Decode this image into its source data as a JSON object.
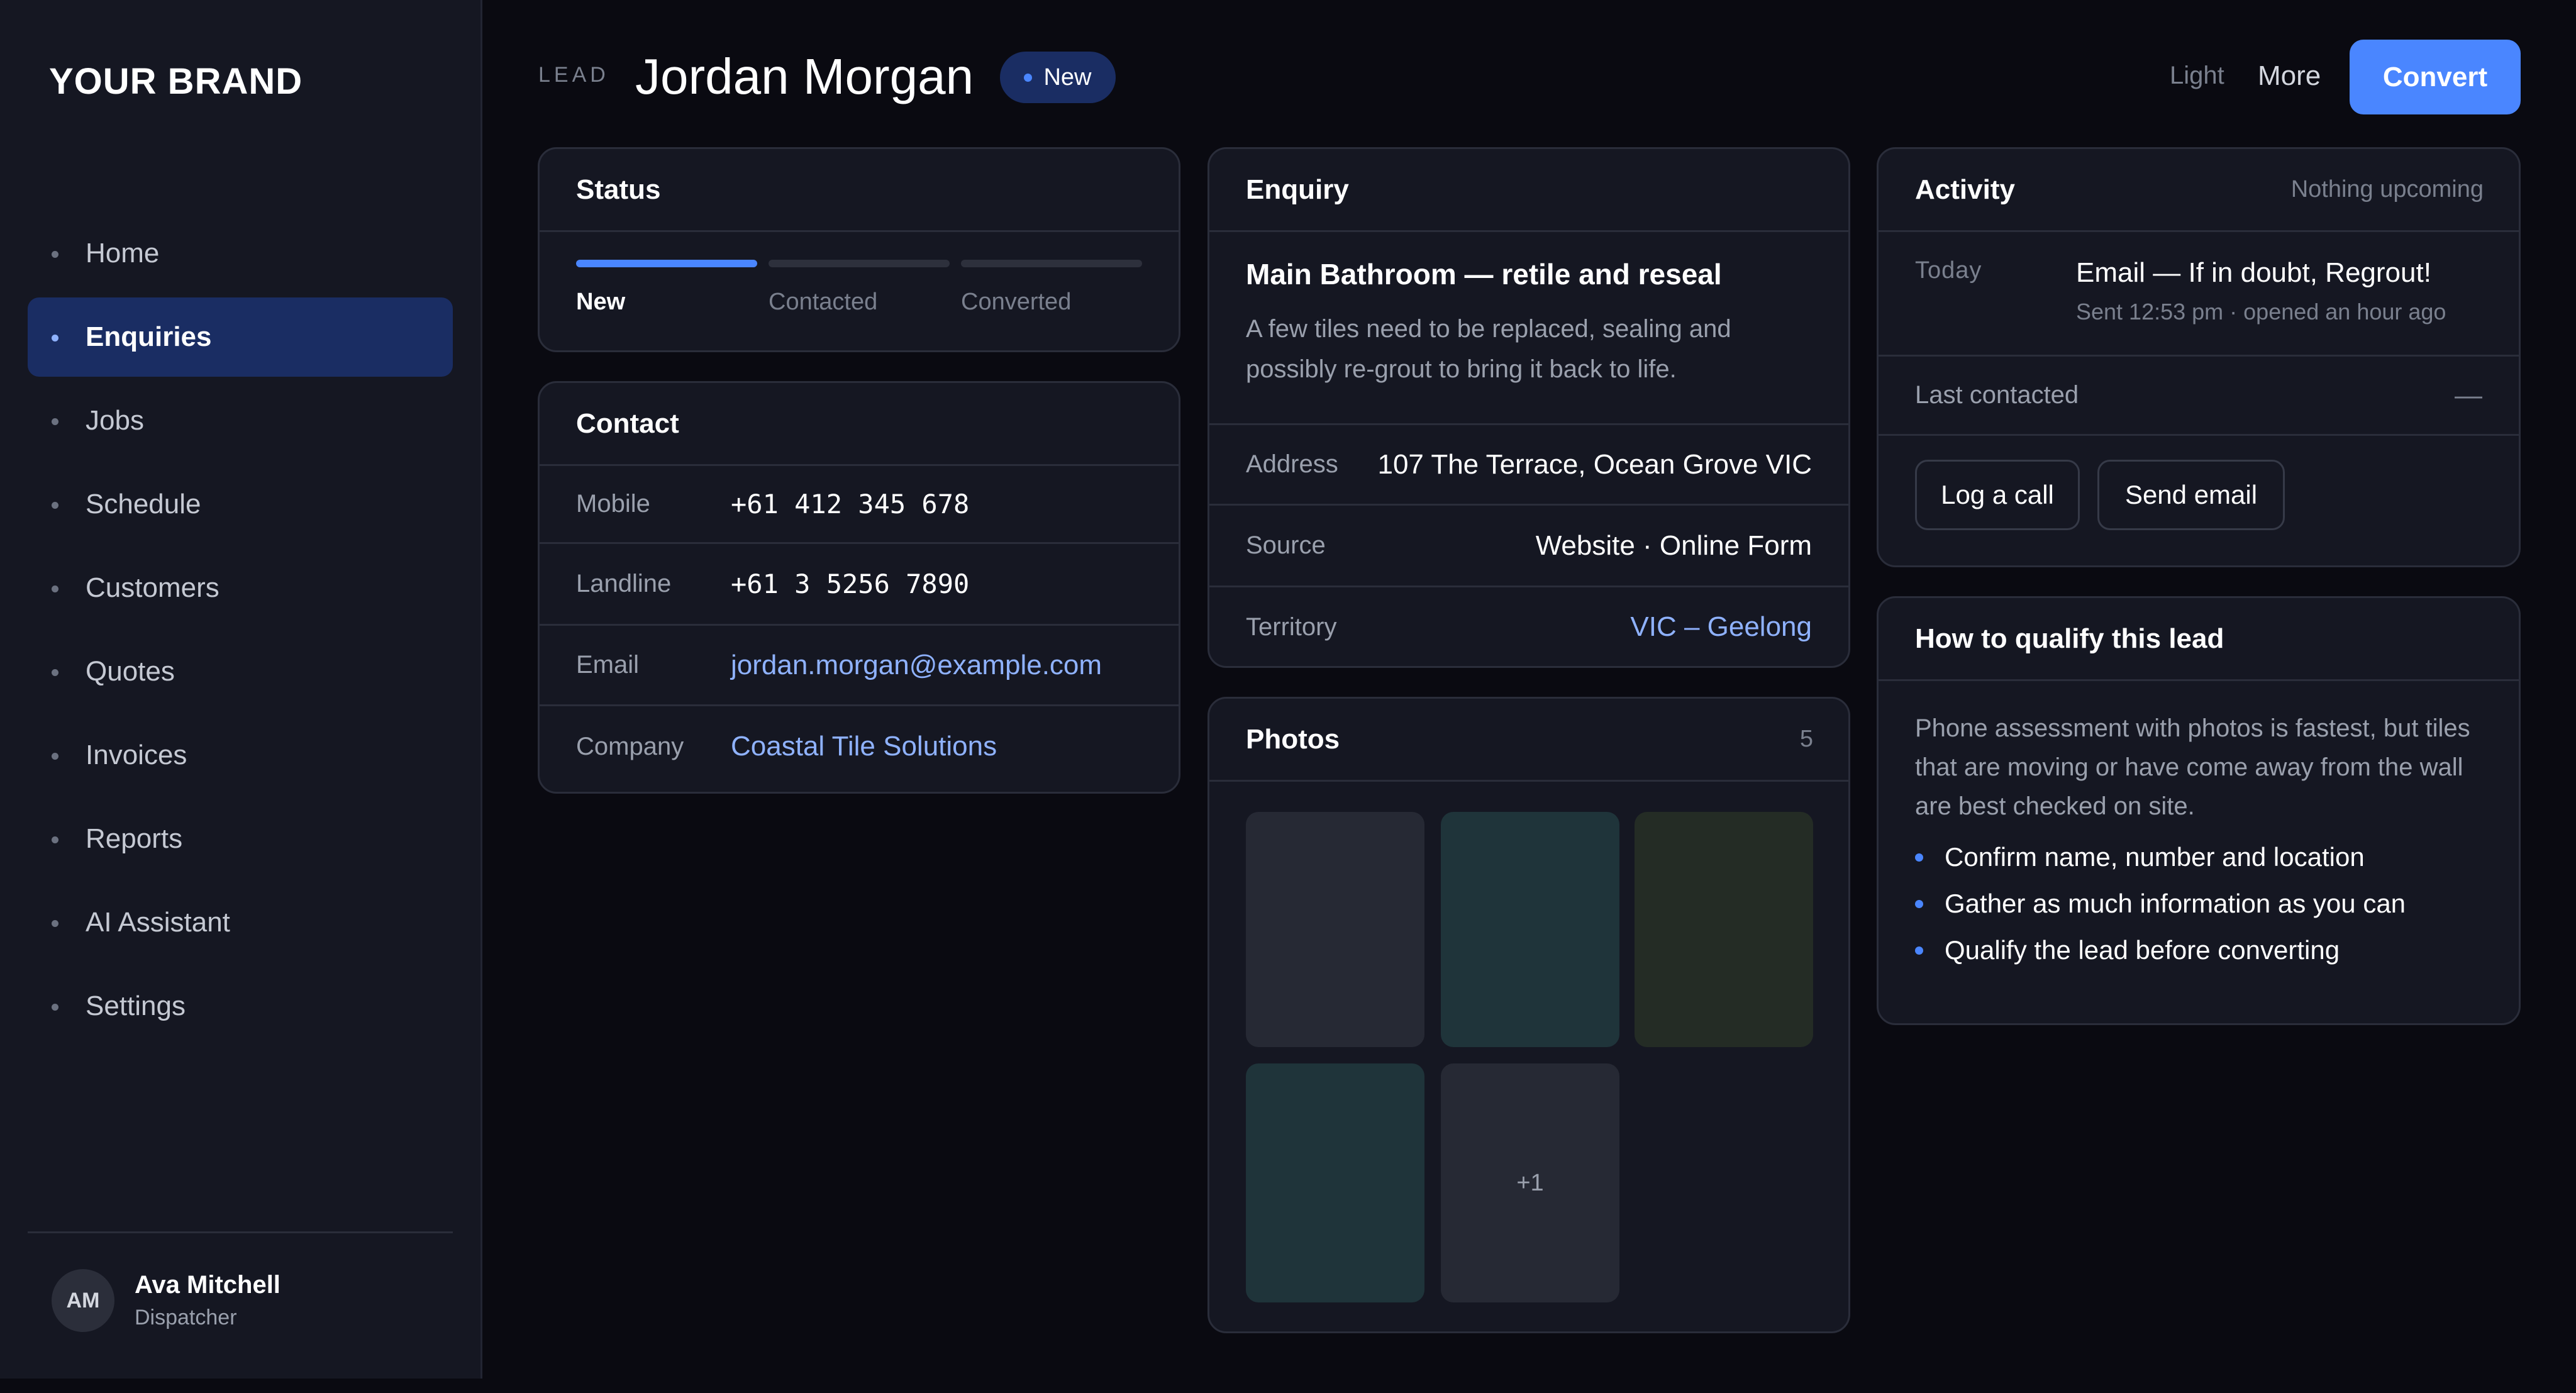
{
  "brand": "YOUR BRAND",
  "nav": {
    "items": [
      {
        "label": "Home"
      },
      {
        "label": "Enquiries",
        "active": true
      },
      {
        "label": "Jobs"
      },
      {
        "label": "Schedule"
      },
      {
        "label": "Customers"
      },
      {
        "label": "Quotes"
      },
      {
        "label": "Invoices"
      },
      {
        "label": "Reports"
      },
      {
        "label": "AI Assistant"
      },
      {
        "label": "Settings"
      }
    ]
  },
  "user": {
    "initials": "AM",
    "name": "Ava Mitchell",
    "role": "Dispatcher"
  },
  "header": {
    "lead_label": "LEAD",
    "name": "Jordan Morgan",
    "badge": "New",
    "light": "Light",
    "more": "More",
    "convert": "Convert"
  },
  "status": {
    "title": "Status",
    "steps": [
      "New",
      "Contacted",
      "Converted"
    ],
    "current_step": "New"
  },
  "contact": {
    "title": "Contact",
    "rows": [
      {
        "key": "Mobile",
        "value": "+61 412 345 678"
      },
      {
        "key": "Landline",
        "value": "+61 3 5256 7890"
      },
      {
        "key": "Email",
        "value": "jordan.morgan@example.com"
      },
      {
        "key": "Company",
        "value": "Coastal Tile Solutions"
      }
    ]
  },
  "enquiry": {
    "title": "Enquiry",
    "subject": "Main Bathroom — retile and reseal",
    "description": "A few tiles need to be replaced, sealing and possibly re-grout to bring it back to life.",
    "rows": [
      {
        "key": "Address",
        "value": "107 The Terrace, Ocean Grove VIC"
      },
      {
        "key": "Source",
        "value": "Website · Online Form"
      },
      {
        "key": "Territory",
        "value": "VIC – Geelong"
      }
    ]
  },
  "photos": {
    "title": "Photos",
    "count": "5",
    "more": "+1",
    "tile_colors": [
      "#262934",
      "#1f343a",
      "#242c25",
      "#1f343a",
      "#262934"
    ]
  },
  "activity": {
    "title": "Activity",
    "upcoming": "Nothing upcoming",
    "today_label": "Today",
    "item_title": "Email — If in doubt, Regrout!",
    "item_sub": "Sent 12:53 pm · opened an hour ago",
    "last_contacted_label": "Last contacted",
    "last_contacted_value": "—",
    "log_call": "Log a call",
    "send_email": "Send email"
  },
  "qualify": {
    "title": "How to qualify this lead",
    "description": "Phone assessment with photos is fastest, but tiles that are moving or have come away from the wall are best checked on site.",
    "items": [
      "Confirm name, number and location",
      "Gather as much information as you can",
      "Qualify the lead before converting"
    ]
  },
  "colors": {
    "accent": "#4a86ff",
    "link": "#8fb2ff",
    "active_nav": "#1a2d63"
  }
}
